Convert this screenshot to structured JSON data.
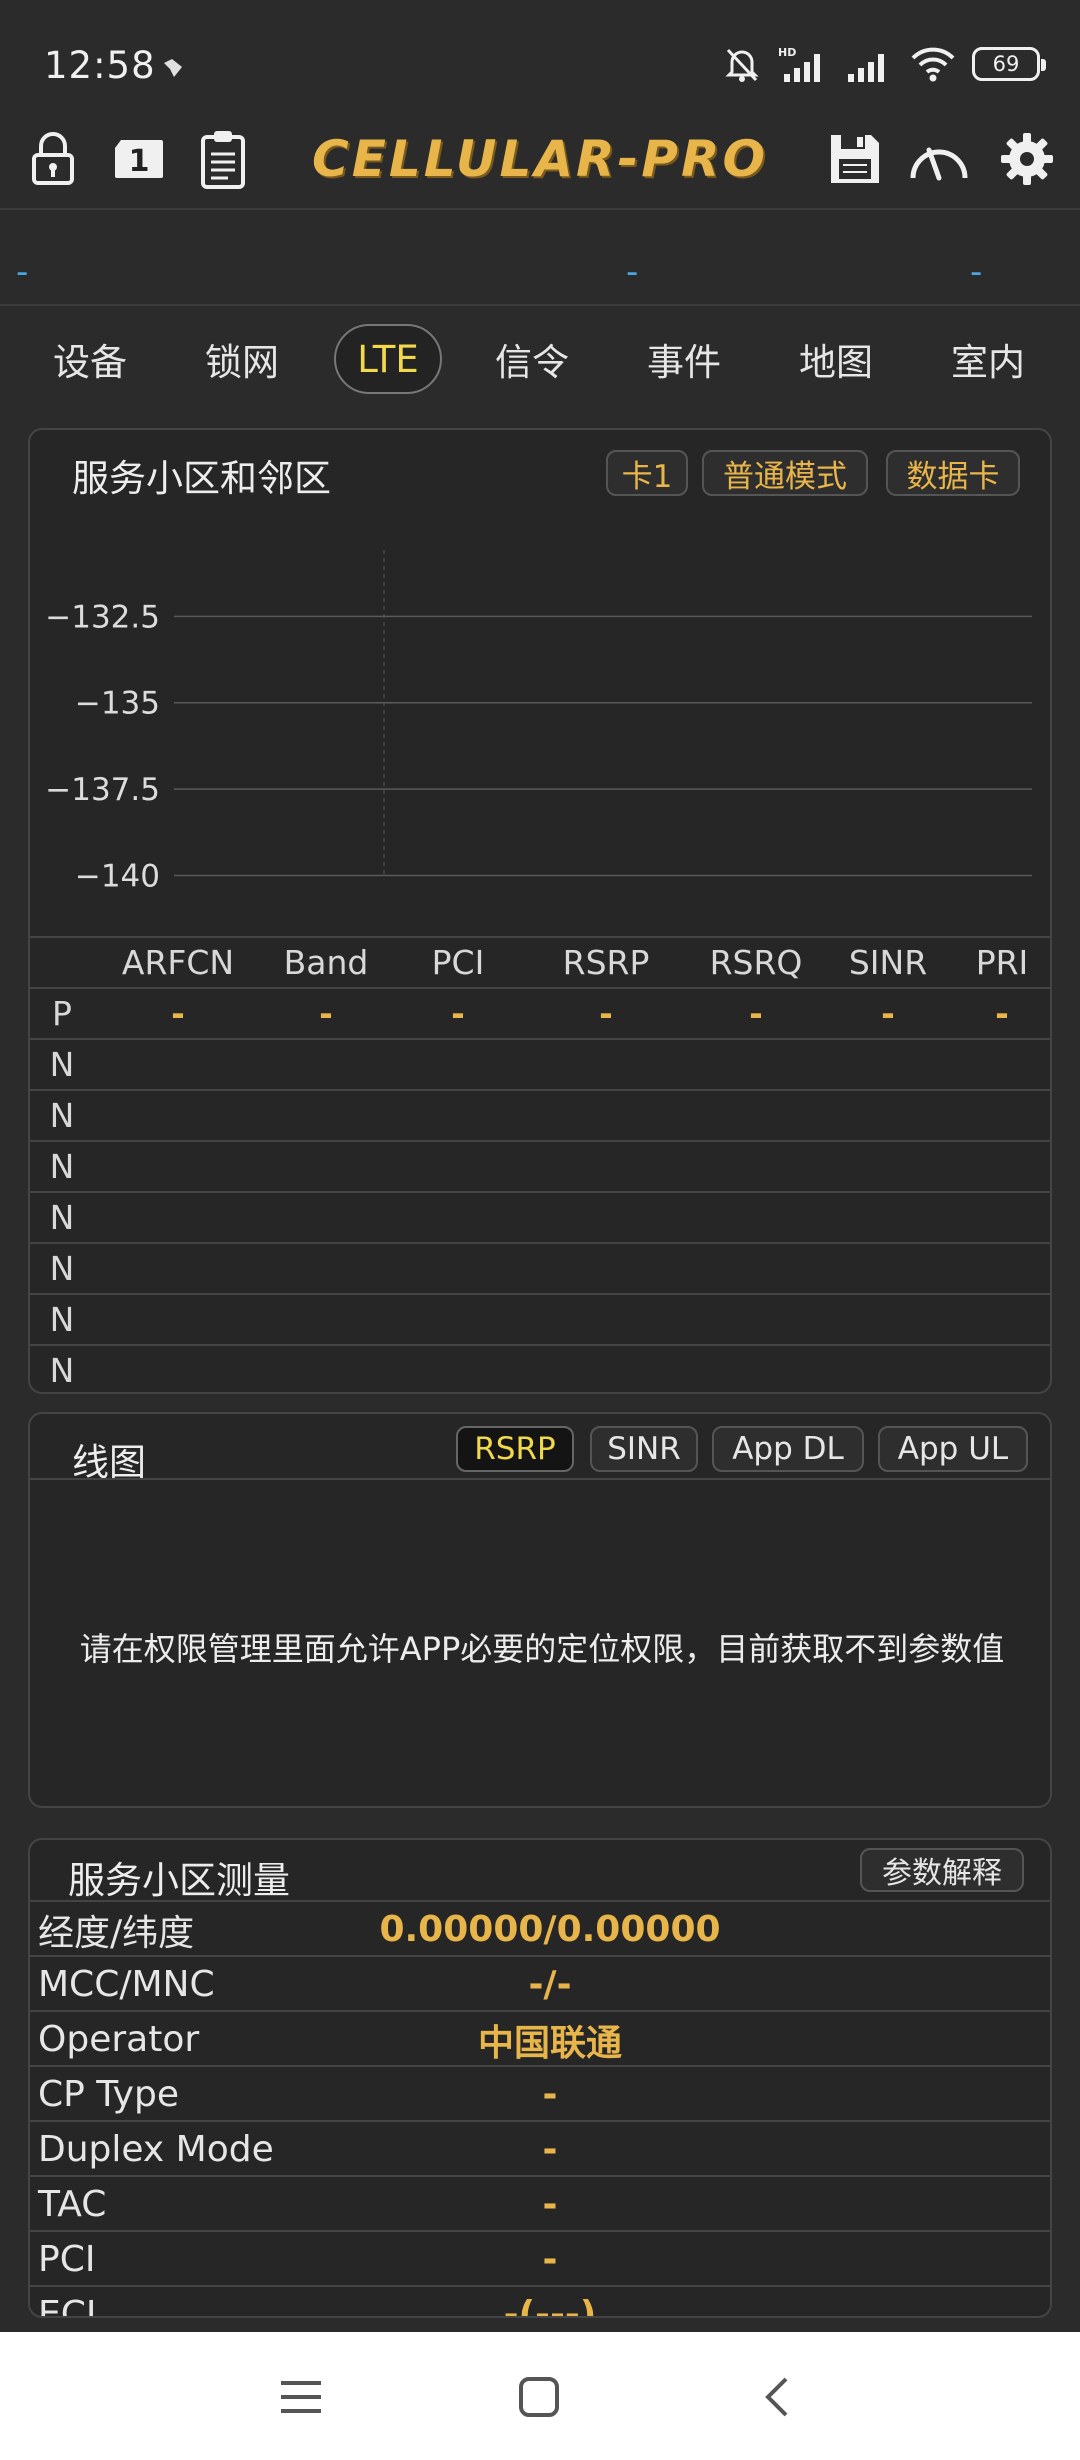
{
  "status": {
    "time": "12:58",
    "battery": "69"
  },
  "toolbar": {
    "logo": "CELLULAR-PRO",
    "sim_badge": "1"
  },
  "infoline": [
    "-",
    "-",
    "-"
  ],
  "tabs": [
    {
      "label": "设备"
    },
    {
      "label": "锁网"
    },
    {
      "label": "LTE"
    },
    {
      "label": "信令"
    },
    {
      "label": "事件"
    },
    {
      "label": "地图"
    },
    {
      "label": "室内"
    }
  ],
  "cells_panel": {
    "title": "服务小区和邻区",
    "chips": [
      "卡1",
      "普通模式",
      "数据卡"
    ],
    "chart_data": {
      "type": "scatter",
      "title": "",
      "xlabel": "",
      "ylabel": "",
      "yticks": [
        "-132.5",
        "-135",
        "-137.5",
        "-140"
      ],
      "ylim": [
        -141,
        -130
      ],
      "series": [],
      "grid": true
    },
    "table": {
      "headers": [
        "",
        "ARFCN",
        "Band",
        "PCI",
        "RSRP",
        "RSRQ",
        "SINR",
        "PRI"
      ],
      "rows": [
        [
          "P",
          "-",
          "-",
          "-",
          "-",
          "-",
          "-",
          "-"
        ],
        [
          "N",
          "",
          "",
          "",
          "",
          "",
          "",
          ""
        ],
        [
          "N",
          "",
          "",
          "",
          "",
          "",
          "",
          ""
        ],
        [
          "N",
          "",
          "",
          "",
          "",
          "",
          "",
          ""
        ],
        [
          "N",
          "",
          "",
          "",
          "",
          "",
          "",
          ""
        ],
        [
          "N",
          "",
          "",
          "",
          "",
          "",
          "",
          ""
        ],
        [
          "N",
          "",
          "",
          "",
          "",
          "",
          "",
          ""
        ],
        [
          "N",
          "",
          "",
          "",
          "",
          "",
          "",
          ""
        ]
      ]
    }
  },
  "line_panel": {
    "title": "线图",
    "chips": [
      "RSRP",
      "SINR",
      "App DL",
      "App UL"
    ],
    "active_chip": "RSRP",
    "notice": "请在权限管理里面允许APP必要的定位权限，目前获取不到参数值"
  },
  "measure_panel": {
    "title": "服务小区测量",
    "button": "参数解释",
    "rows": [
      {
        "key": "经度/纬度",
        "value": "0.00000/0.00000"
      },
      {
        "key": "MCC/MNC",
        "value": "-/-"
      },
      {
        "key": "Operator",
        "value": "中国联通"
      },
      {
        "key": "CP Type",
        "value": "-"
      },
      {
        "key": "Duplex Mode",
        "value": "-"
      },
      {
        "key": "TAC",
        "value": "-"
      },
      {
        "key": "PCI",
        "value": "-"
      },
      {
        "key": "ECI",
        "value": "-(---)"
      }
    ]
  },
  "colors": {
    "accent_gold": "#e8b54a",
    "active_yellow": "#f2d94b",
    "info_blue": "#4aa6e0",
    "background": "#2b2b2b"
  },
  "icons": [
    "do-not-disturb-bell-icon",
    "hd-signal-icon",
    "signal-icon",
    "wifi-icon",
    "battery-icon",
    "lock-icon",
    "sim-card-icon",
    "clipboard-icon",
    "save-icon",
    "speedometer-icon",
    "gear-icon",
    "menu-icon",
    "home-icon",
    "back-icon"
  ]
}
